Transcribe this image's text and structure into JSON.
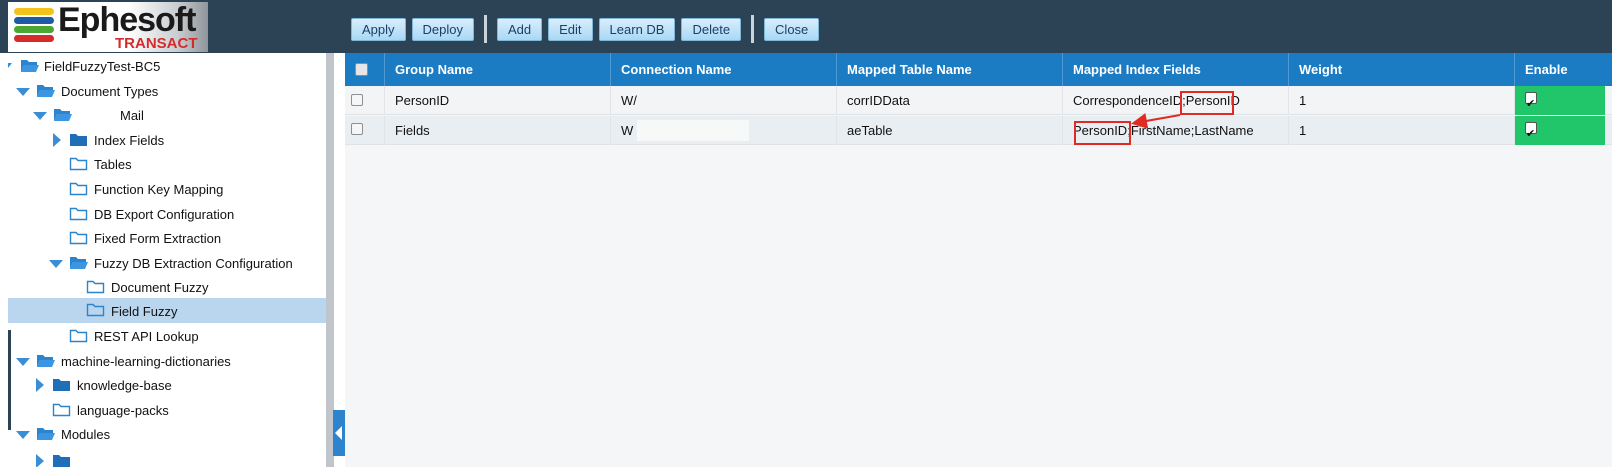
{
  "logo": {
    "name": "Ephesoft",
    "sub": "TRANSACT"
  },
  "toolbar": {
    "buttons": [
      "Apply",
      "Deploy",
      "Add",
      "Edit",
      "Learn DB",
      "Delete",
      "Close"
    ]
  },
  "sidebar": {
    "items": [
      {
        "label": "FieldFuzzyTest-BC5"
      },
      {
        "label": "Document Types"
      },
      {
        "label": "Mail"
      },
      {
        "label": "Index Fields"
      },
      {
        "label": "Tables"
      },
      {
        "label": "Function Key Mapping"
      },
      {
        "label": "DB Export Configuration"
      },
      {
        "label": "Fixed Form Extraction"
      },
      {
        "label": "Fuzzy DB Extraction Configuration"
      },
      {
        "label": "Document Fuzzy"
      },
      {
        "label": "Field Fuzzy"
      },
      {
        "label": "REST API Lookup"
      },
      {
        "label": "machine-learning-dictionaries"
      },
      {
        "label": "knowledge-base"
      },
      {
        "label": "language-packs"
      },
      {
        "label": "Modules"
      }
    ],
    "selected": "Field Fuzzy"
  },
  "grid": {
    "columns": [
      "Group Name",
      "Connection Name",
      "Mapped Table Name",
      "Mapped Index Fields",
      "Weight",
      "Enable"
    ],
    "rows": [
      {
        "group": "PersonID",
        "connection": "W/",
        "table": "corrIDData",
        "fields_prefix": "CorrespondenceID;",
        "fields_key": "PersonID",
        "fields_suffix": "",
        "weight": "1",
        "enabled": true
      },
      {
        "group": "Fields",
        "connection": "W",
        "table": "aeTable",
        "fields_prefix": "",
        "fields_key": "PersonID;",
        "fields_suffix": "FirstName;LastName",
        "weight": "1",
        "enabled": true
      }
    ]
  },
  "colors": {
    "header_bg": "#2c4356",
    "grid_header": "#1b7bc3",
    "enable_cell": "#22c66a",
    "highlight": "#e12b22",
    "selected_row": "#b9d6ee"
  }
}
